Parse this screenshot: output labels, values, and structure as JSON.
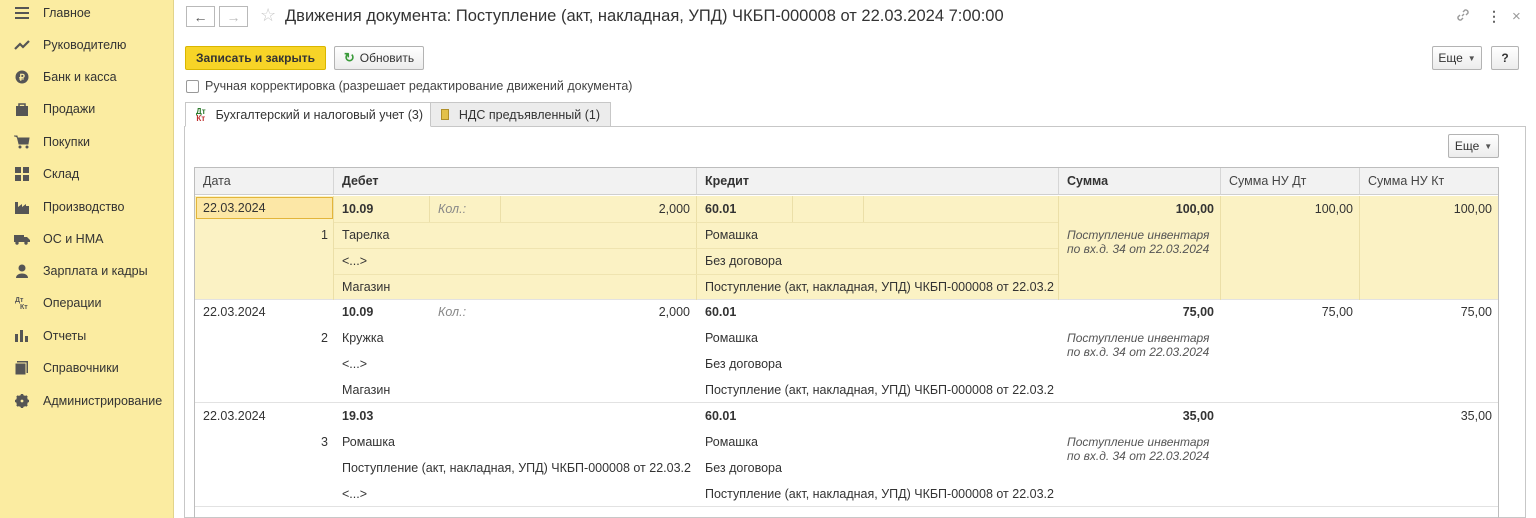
{
  "sidebar": {
    "items": [
      {
        "label": "Главное",
        "icon": "menu-icon"
      },
      {
        "label": "Руководителю",
        "icon": "trend-icon"
      },
      {
        "label": "Банк и касса",
        "icon": "coin-icon"
      },
      {
        "label": "Продажи",
        "icon": "bag-icon"
      },
      {
        "label": "Покупки",
        "icon": "cart-icon"
      },
      {
        "label": "Склад",
        "icon": "warehouse-icon"
      },
      {
        "label": "Производство",
        "icon": "factory-icon"
      },
      {
        "label": "ОС и НМА",
        "icon": "truck-icon"
      },
      {
        "label": "Зарплата и кадры",
        "icon": "person-icon"
      },
      {
        "label": "Операции",
        "icon": "dt-kt-icon"
      },
      {
        "label": "Отчеты",
        "icon": "bar-chart-icon"
      },
      {
        "label": "Справочники",
        "icon": "book-icon"
      },
      {
        "label": "Администрирование",
        "icon": "gear-icon"
      }
    ]
  },
  "header": {
    "title": "Движения документа: Поступление (акт, накладная, УПД) ЧКБП-000008 от 22.03.2024 7:00:00"
  },
  "toolbar": {
    "save_close": "Записать и закрыть",
    "refresh": "Обновить",
    "more": "Еще",
    "help": "?"
  },
  "manual_correction": {
    "label": "Ручная корректировка (разрешает редактирование движений документа)",
    "checked": false
  },
  "tabs": [
    {
      "label": "Бухгалтерский и налоговый учет (3)",
      "active": true
    },
    {
      "label": "НДС предъявленный (1)",
      "active": false
    }
  ],
  "panel": {
    "more": "Еще"
  },
  "table": {
    "columns": [
      "Дата",
      "Дебет",
      "Кредит",
      "Сумма",
      "Сумма НУ Дт",
      "Сумма НУ Кт"
    ],
    "rows": [
      {
        "date": "22.03.2024",
        "num": "1",
        "debit_account": "10.09",
        "qty_label": "Кол.:",
        "qty": "2,000",
        "debit_sub1": "Тарелка",
        "debit_sub2": "<...>",
        "debit_sub3": "Магазин",
        "credit_account": "60.01",
        "credit_sub1": "Ромашка",
        "credit_sub2": "Без договора",
        "credit_sub3": "Поступление (акт, накладная, УПД) ЧКБП-000008 от 22.03.2...",
        "sum": "100,00",
        "note1": "Поступление инвентаря",
        "note2": "по вх.д. 34 от 22.03.2024",
        "nu_dt": "100,00",
        "nu_kt": "100,00"
      },
      {
        "date": "22.03.2024",
        "num": "2",
        "debit_account": "10.09",
        "qty_label": "Кол.:",
        "qty": "2,000",
        "debit_sub1": "Кружка",
        "debit_sub2": "<...>",
        "debit_sub3": "Магазин",
        "credit_account": "60.01",
        "credit_sub1": "Ромашка",
        "credit_sub2": "Без договора",
        "credit_sub3": "Поступление (акт, накладная, УПД) ЧКБП-000008 от 22.03.2...",
        "sum": "75,00",
        "note1": "Поступление инвентаря",
        "note2": "по вх.д. 34 от 22.03.2024",
        "nu_dt": "75,00",
        "nu_kt": "75,00"
      },
      {
        "date": "22.03.2024",
        "num": "3",
        "debit_account": "19.03",
        "qty_label": "",
        "qty": "",
        "debit_sub1": "Ромашка",
        "debit_sub2": "Поступление (акт, накладная, УПД) ЧКБП-000008 от 22.03.2...",
        "debit_sub3": "<...>",
        "credit_account": "60.01",
        "credit_sub1": "Ромашка",
        "credit_sub2": "Без договора",
        "credit_sub3": "Поступление (акт, накладная, УПД) ЧКБП-000008 от 22.03.2...",
        "sum": "35,00",
        "note1": "Поступление инвентаря",
        "note2": "по вх.д. 34 от 22.03.2024",
        "nu_dt": "",
        "nu_kt": "35,00"
      }
    ]
  }
}
